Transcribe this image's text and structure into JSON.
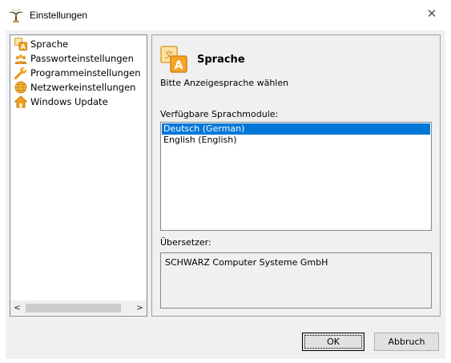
{
  "window": {
    "title": "Einstellungen",
    "close_symbol": "✕"
  },
  "icons": {
    "app": "palm-tree-icon",
    "sprache": "language-icon",
    "passwort": "users-icon",
    "programm": "wrench-icon",
    "netzwerk": "globe-icon",
    "update": "house-icon"
  },
  "tree": {
    "items": [
      {
        "label": "Sprache"
      },
      {
        "label": "Passworteinstellungen"
      },
      {
        "label": "Programmeinstellungen"
      },
      {
        "label": "Netzwerkeinstellungen"
      },
      {
        "label": "Windows Update"
      }
    ],
    "scroll_left": "<",
    "scroll_right": ">"
  },
  "content": {
    "title": "Sprache",
    "subtitle": "Bitte Anzeigesprache wählen",
    "modules_label": "Verfügbare Sprachmodule:",
    "modules": [
      {
        "label": "Deutsch (German)",
        "selected": true
      },
      {
        "label": "English (English)",
        "selected": false
      }
    ],
    "translator_label": "Übersetzer:",
    "translator": "SCHWARZ Computer Systeme GmbH"
  },
  "buttons": {
    "ok": "OK",
    "cancel": "Abbruch"
  },
  "colors": {
    "selection": "#0078d7",
    "dialog_bg": "#f0f0f0"
  }
}
